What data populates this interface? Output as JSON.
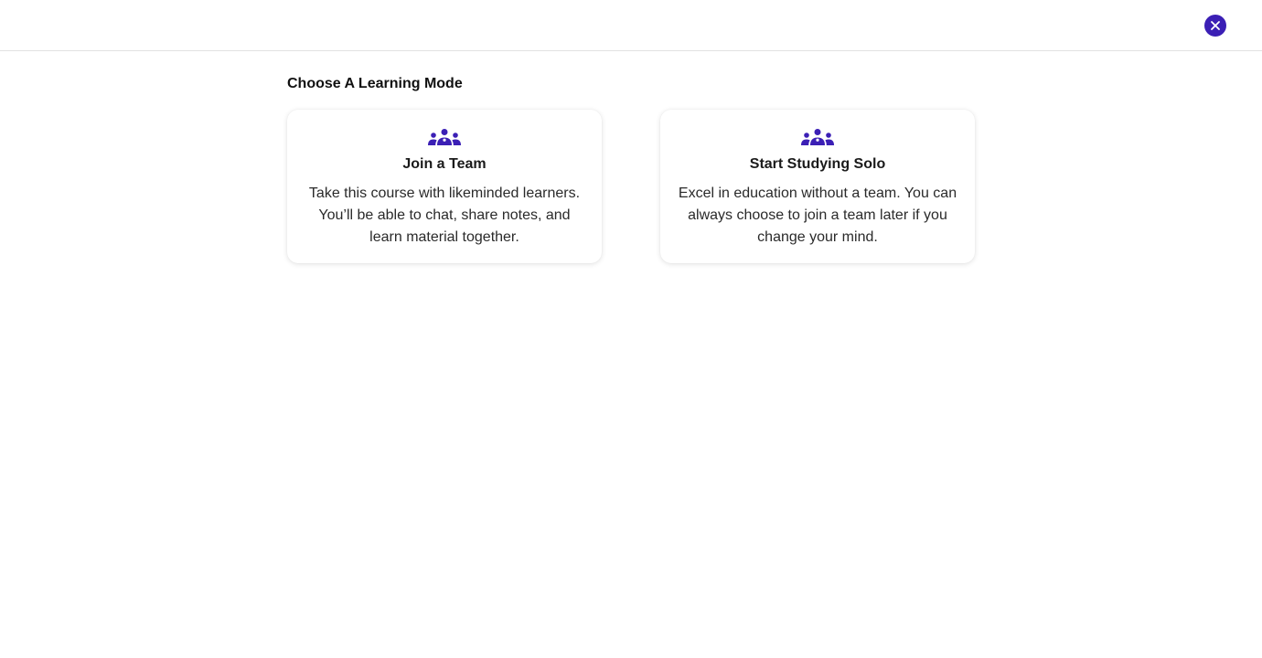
{
  "topbar": {
    "close_icon": "close-icon",
    "accent_color": "#3b1fb5"
  },
  "main": {
    "heading": "Choose A Learning Mode",
    "cards": [
      {
        "icon": "group-icon",
        "title": "Join a Team",
        "description": "Take this course with likeminded learners. You’ll be able to chat, share notes, and learn material together."
      },
      {
        "icon": "group-icon",
        "title": "Start Studying Solo",
        "description": "Excel in education without a team. You can always choose to join a team later if you change your mind."
      }
    ]
  }
}
